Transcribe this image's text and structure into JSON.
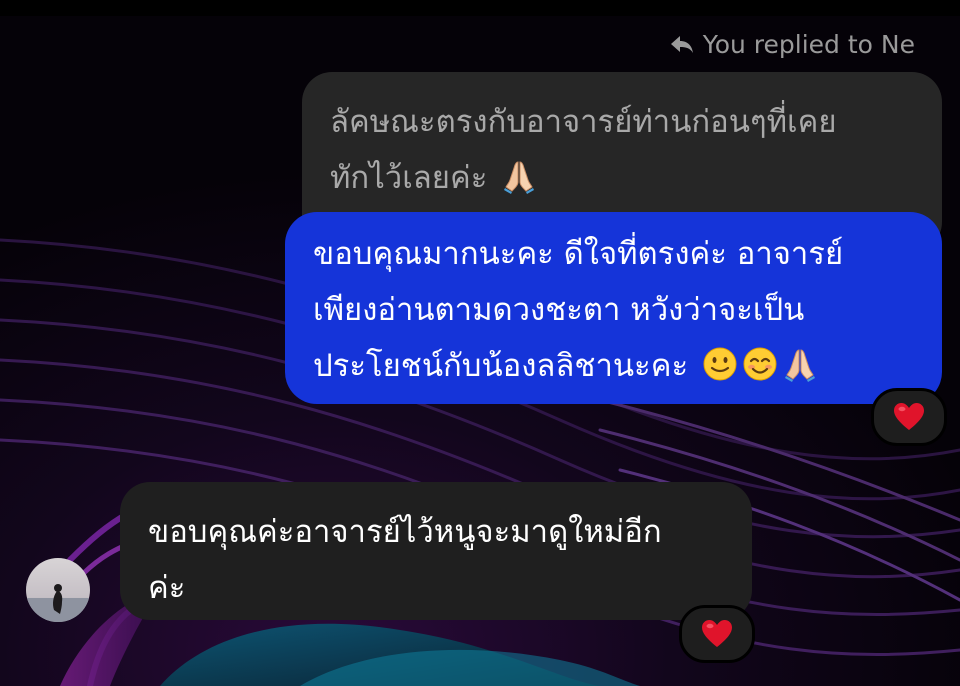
{
  "conversation": {
    "reply_indicator": {
      "icon": "reply-arrow-icon",
      "text": "You replied to Ne"
    },
    "quoted_message": {
      "line1": "ลัคษณะตรงกับอาจารย์ท่านก่อนๆที่เคย",
      "line2": "ทักไว้เลยค่ะ",
      "emoji": "folded-hands-icon"
    },
    "sent_message": {
      "line1": "ขอบคุณมากนะคะ ดีใจที่ตรงค่ะ อาจารย์",
      "line2": "เพียงอ่านตามดวงชะตา หวังว่าจะเป็น",
      "line3": "ประโยชน์กับน้องลลิชานะคะ",
      "emojis": [
        "slightly-smiling-face-icon",
        "smiling-face-with-smiling-eyes-icon",
        "folded-hands-icon"
      ],
      "reaction": "red-heart-icon"
    },
    "received_message": {
      "line1": "ขอบคุณค่ะอาจารย์ไว้หนูจะมาดูใหม่อีก",
      "line2": "ค่ะ",
      "reaction": "red-heart-icon"
    }
  },
  "colors": {
    "sent_bubble": "#1534d9",
    "received_bubble": "#1f1f1f",
    "quoted_bubble": "#262626",
    "heart": "#e0142b"
  }
}
